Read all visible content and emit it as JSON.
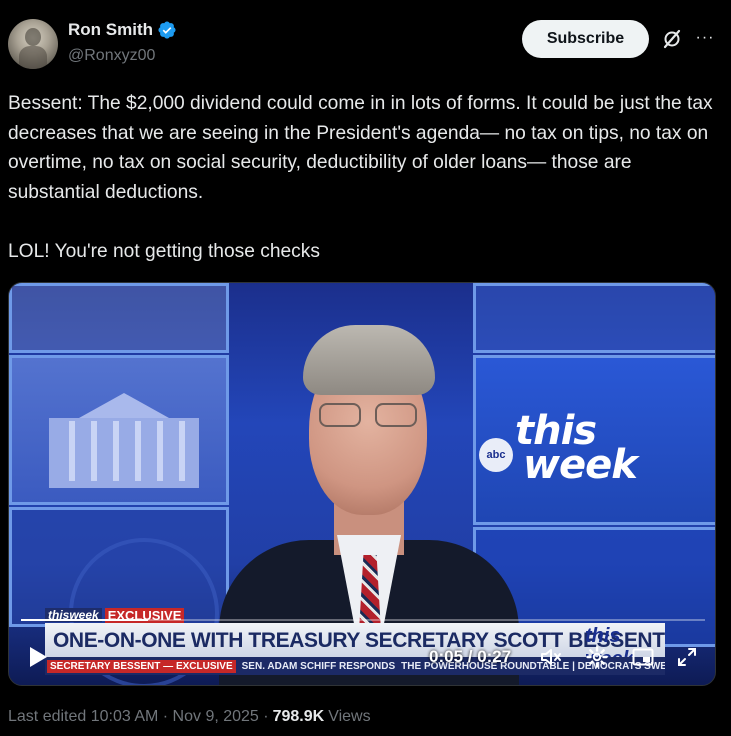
{
  "author": {
    "name": "Ron Smith",
    "handle": "@Ronxyz00",
    "verified": true,
    "accent": "#1d9bf0"
  },
  "actions": {
    "subscribe_label": "Subscribe",
    "grok_icon": "grok-icon",
    "more_icon": "more-dots-icon",
    "more_label": "···"
  },
  "tweet": {
    "text": "Bessent: The $2,000 dividend could come in in lots of forms. It could be just the tax decreases that we are seeing in the President's agenda— no tax on tips, no tax on overtime, no tax on social security, deductibility of older loans— those are substantial deductions.\n\nLOL! You're not getting those checks"
  },
  "video": {
    "chyron_brand": "thisweek",
    "chyron_tag": "EXCLUSIVE",
    "chyron_headline": "ONE-ON-ONE WITH TREASURY SECRETARY SCOTT BESSENT",
    "chyron_logo_text": "this week",
    "ticker_red": "SECRETARY BESSENT — EXCLUSIVE",
    "ticker_1": "SEN. ADAM SCHIFF RESPONDS",
    "ticker_2": "THE POWERHOUSE ROUNDTABLE | DEMOCRATS SWEEP KEY RACES",
    "studio_logo_abc": "abc",
    "studio_logo_line1": "this",
    "studio_logo_line2": "week",
    "time_label": "0:05 / 0:27",
    "progress_fraction": 0.185
  },
  "meta": {
    "edited_label": "Last edited 10:03 AM · Nov 9, 2025 ·",
    "views_count": "798.9K",
    "views_label": "Views"
  }
}
